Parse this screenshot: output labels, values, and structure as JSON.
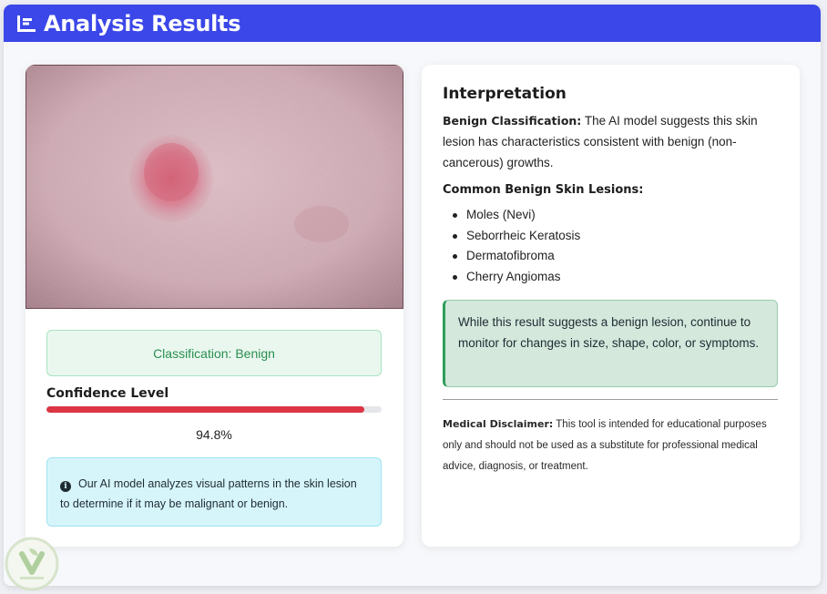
{
  "header": {
    "title": "Analysis Results",
    "icon": "bar-chart-icon",
    "color": "#3b47e8"
  },
  "result": {
    "classification_label": "Classification: Benign",
    "confidence_label": "Confidence Level",
    "confidence_value": "94.8%",
    "confidence_fraction": 0.948,
    "bar_color": "#dc3545",
    "info_text": "Our AI model analyzes visual patterns in the skin lesion to determine if it may be malignant or benign.",
    "info_icon": "info-circle-icon"
  },
  "interpretation": {
    "title": "Interpretation",
    "benign_heading": "Benign Classification:",
    "benign_text": "The AI model suggests this skin lesion has characteristics consistent with benign (non-cancerous) growths.",
    "list_title": "Common Benign Skin Lesions:",
    "list_items": [
      "Moles (Nevi)",
      "Seborrheic Keratosis",
      "Dermatofibroma",
      "Cherry Angiomas"
    ],
    "monitor_text": "While this result suggests a benign lesion, continue to monitor for changes in size, shape, color, or symptoms.",
    "disclaimer_heading": "Medical Disclaimer:",
    "disclaimer_text": "This tool is intended for educational purposes only and should not be used as a substitute for professional medical advice, diagnosis, or treatment."
  }
}
